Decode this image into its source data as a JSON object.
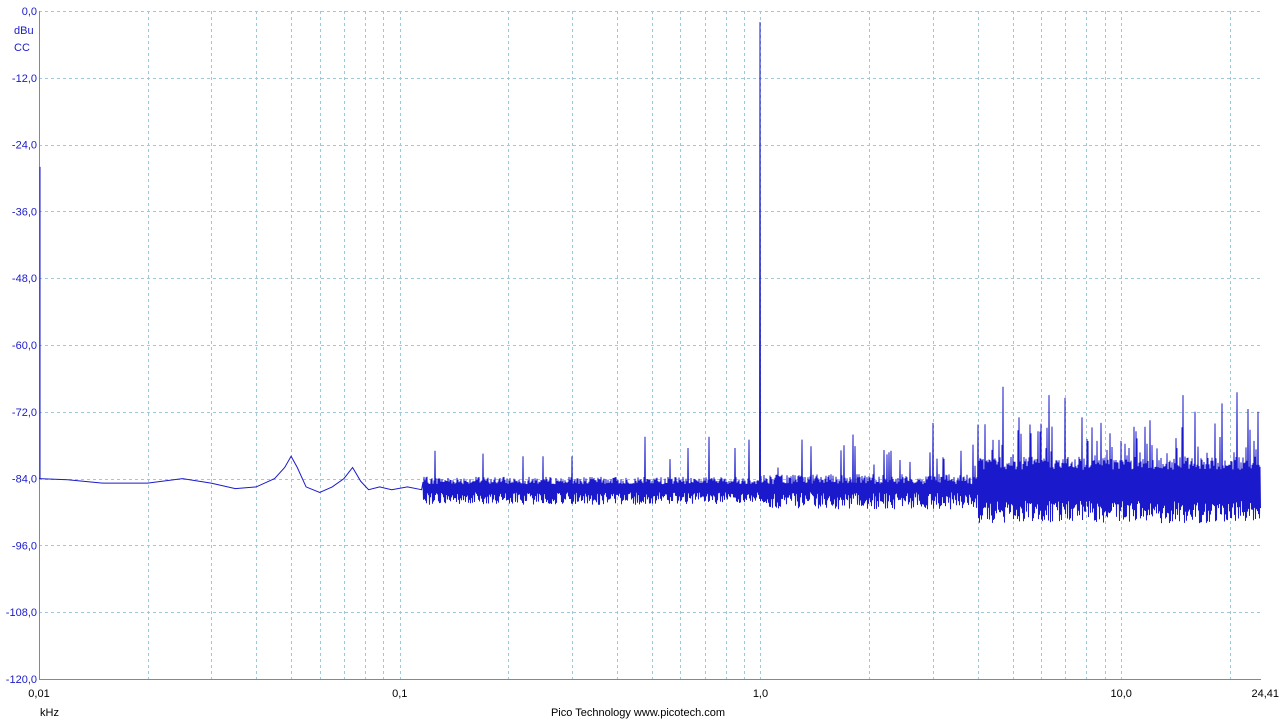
{
  "chart_data": {
    "type": "line",
    "x_scale": "log",
    "xlim": [
      0.01,
      24.41
    ],
    "ylim": [
      -120.0,
      0.0
    ],
    "y_ticks": [
      "0,0",
      "-12,0",
      "-24,0",
      "-36,0",
      "-48,0",
      "-60,0",
      "-72,0",
      "-84,0",
      "-96,0",
      "-108,0",
      "-120,0"
    ],
    "x_ticks": [
      {
        "value": 0.01,
        "label": "0,01"
      },
      {
        "value": 0.1,
        "label": "0,1"
      },
      {
        "value": 1.0,
        "label": "1,0"
      },
      {
        "value": 10.0,
        "label": "10,0"
      },
      {
        "value": 24.41,
        "label": "24,41"
      }
    ],
    "y_unit": "dBu",
    "y_coupling": "CC",
    "x_unit": "kHz",
    "footer": "Pico Technology   www.picotech.com",
    "grid": true,
    "line_color": "#1a1acc",
    "grid_color": "#9fc8d8",
    "series": [
      {
        "baseline": [
          [
            0.01,
            -84.0
          ],
          [
            0.012,
            -84.2
          ],
          [
            0.015,
            -84.8
          ],
          [
            0.02,
            -84.8
          ],
          [
            0.025,
            -84.0
          ],
          [
            0.03,
            -84.8
          ],
          [
            0.035,
            -85.8
          ],
          [
            0.04,
            -85.5
          ],
          [
            0.045,
            -84.0
          ],
          [
            0.048,
            -82.0
          ],
          [
            0.05,
            -80.0
          ],
          [
            0.052,
            -82.0
          ],
          [
            0.055,
            -85.5
          ],
          [
            0.06,
            -86.5
          ],
          [
            0.065,
            -85.5
          ],
          [
            0.07,
            -84.0
          ],
          [
            0.074,
            -82.0
          ],
          [
            0.078,
            -84.5
          ],
          [
            0.082,
            -86.0
          ],
          [
            0.088,
            -85.5
          ],
          [
            0.095,
            -86.0
          ],
          [
            0.105,
            -85.5
          ],
          [
            0.115,
            -86.0
          ]
        ],
        "peaks": [
          [
            0.125,
            -79.0
          ],
          [
            0.17,
            -79.5
          ],
          [
            0.22,
            -80.0
          ],
          [
            0.25,
            -80.0
          ],
          [
            0.3,
            -80.0
          ],
          [
            0.48,
            -76.5
          ],
          [
            0.56,
            -80.5
          ],
          [
            0.63,
            -78.5
          ],
          [
            0.72,
            -76.5
          ],
          [
            0.85,
            -78.5
          ],
          [
            0.93,
            -77.0
          ],
          [
            1.0,
            -2.0
          ],
          [
            1.12,
            -82.0
          ],
          [
            1.3,
            -77.0
          ],
          [
            1.7,
            -78.0
          ],
          [
            2.3,
            -79.0
          ],
          [
            2.6,
            -81.0
          ],
          [
            3.0,
            -74.0
          ],
          [
            3.6,
            -79.0
          ],
          [
            4.7,
            -67.5
          ],
          [
            5.2,
            -73.0
          ],
          [
            6.3,
            -69.0
          ],
          [
            7.0,
            -69.5
          ],
          [
            7.8,
            -73.0
          ],
          [
            8.8,
            -74.0
          ],
          [
            11.0,
            -75.5
          ],
          [
            12.0,
            -73.5
          ],
          [
            14.8,
            -69.0
          ],
          [
            16.0,
            -72.0
          ],
          [
            19.0,
            -70.5
          ],
          [
            21.0,
            -68.5
          ],
          [
            22.5,
            -71.5
          ],
          [
            24.0,
            -72.0
          ]
        ]
      }
    ]
  }
}
